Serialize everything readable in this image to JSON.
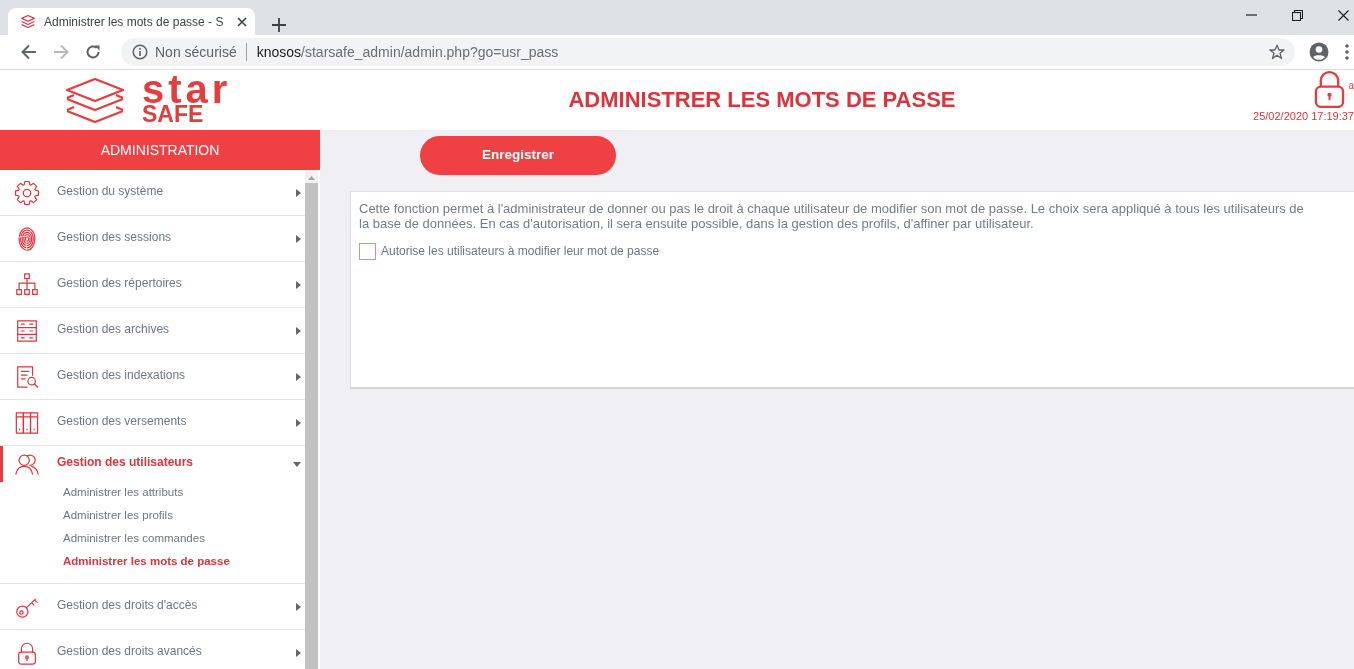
{
  "browser": {
    "tab": {
      "title": "Administrer les mots de passe - S"
    },
    "address": {
      "security": "Non sécurisé",
      "host": "knosos",
      "path": "/starsafe_admin/admin.php?go=usr_pass"
    }
  },
  "header": {
    "logo": {
      "line_1": "star",
      "line_2": "SAFE"
    },
    "title": "ADMINISTRER LES MOTS DE PASSE",
    "user": "a",
    "datetime": "25/02/2020 17:19:37"
  },
  "sidebar": {
    "title": "ADMINISTRATION",
    "items": [
      {
        "label": "Gestion du système",
        "expanded": false
      },
      {
        "label": "Gestion des sessions",
        "expanded": false
      },
      {
        "label": "Gestion des répertoires",
        "expanded": false
      },
      {
        "label": "Gestion des archives",
        "expanded": false
      },
      {
        "label": "Gestion des indexations",
        "expanded": false
      },
      {
        "label": "Gestion des versements",
        "expanded": false
      },
      {
        "label": "Gestion des utilisateurs",
        "expanded": true,
        "children": [
          {
            "label": "Administrer les attributs",
            "selected": false
          },
          {
            "label": "Administrer les profils",
            "selected": false
          },
          {
            "label": "Administrer les commandes",
            "selected": false
          },
          {
            "label": "Administrer les mots de passe",
            "selected": true
          }
        ]
      },
      {
        "label": "Gestion des droits d'accès",
        "expanded": false
      },
      {
        "label": "Gestion des droits avancés",
        "expanded": false
      }
    ]
  },
  "content": {
    "save_button": "Enregistrer",
    "description": "Cette fonction permet à l'administrateur de donner ou pas le droit à chaque utilisateur de modifier son mot de passe. Le choix sera appliqué à tous les utilisateurs de la base de données. En cas d'autorisation, il sera ensuite possible, dans la gestion des profils, d'affiner par utilisateur.",
    "checkbox": {
      "label": "Autorise les utilisateurs à modifier leur mot de passe",
      "checked": false
    }
  }
}
